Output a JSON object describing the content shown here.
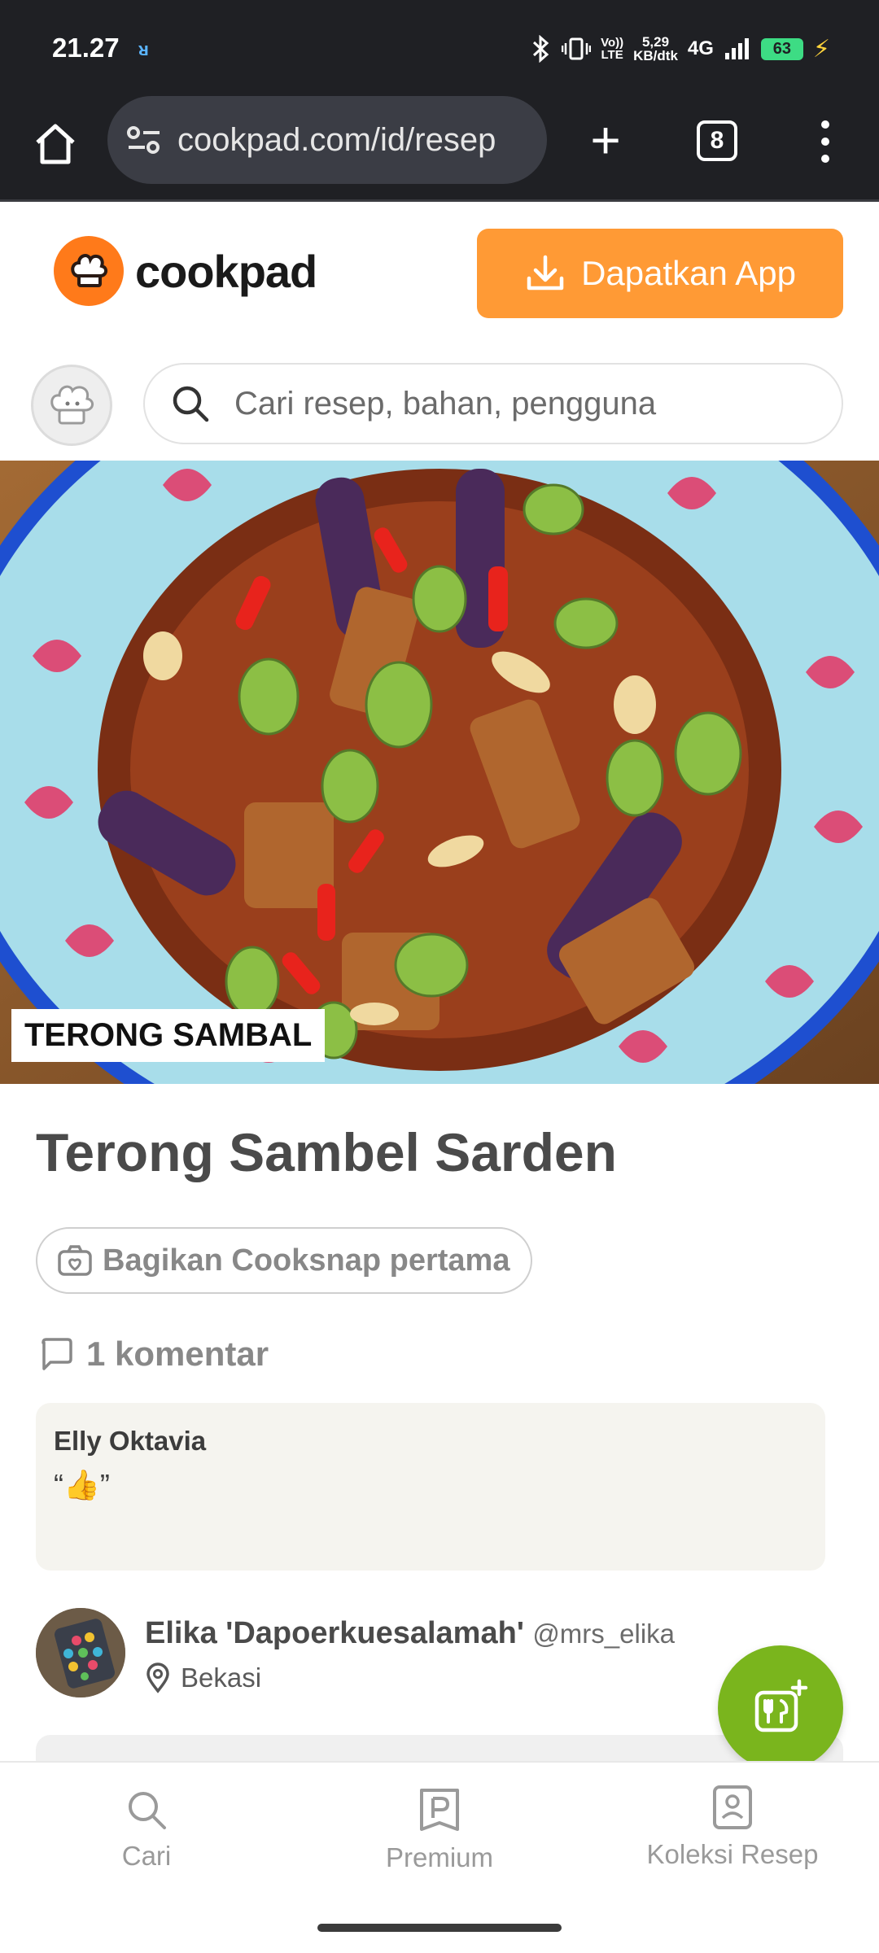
{
  "status_bar": {
    "time": "21.27",
    "network_top": "5,29",
    "network_bottom": "KB/dtk",
    "volte_top": "Vo))",
    "volte_bottom": "LTE",
    "network_type": "4G",
    "battery": "63"
  },
  "browser": {
    "url": "cookpad.com/id/resep",
    "tab_count": "8"
  },
  "header": {
    "logo_text": "cookpad",
    "get_app_label": "Dapatkan App"
  },
  "search": {
    "placeholder": "Cari resep, bahan, pengguna"
  },
  "hero": {
    "overlay_label": "TERONG SAMBAL"
  },
  "recipe": {
    "title": "Terong Sambel Sarden",
    "cooksnap_label": "Bagikan Cooksnap pertama",
    "comments_label": "1 komentar"
  },
  "comments": [
    {
      "author": "Elly Oktavia",
      "text": "“👍”"
    }
  ],
  "author": {
    "name": "Elika 'Dapoerkuesalamah'",
    "handle": "@mrs_elika",
    "location": "Bekasi"
  },
  "bottom_nav": {
    "items": [
      {
        "label": "Cari",
        "icon": "search-icon"
      },
      {
        "label": "Premium",
        "icon": "premium-icon"
      },
      {
        "label": "Koleksi Resep",
        "icon": "recipe-collection-icon"
      }
    ]
  },
  "colors": {
    "brand_orange": "#ff9a35",
    "fab_green": "#7ab51d",
    "browser_dark": "#1f2024"
  }
}
